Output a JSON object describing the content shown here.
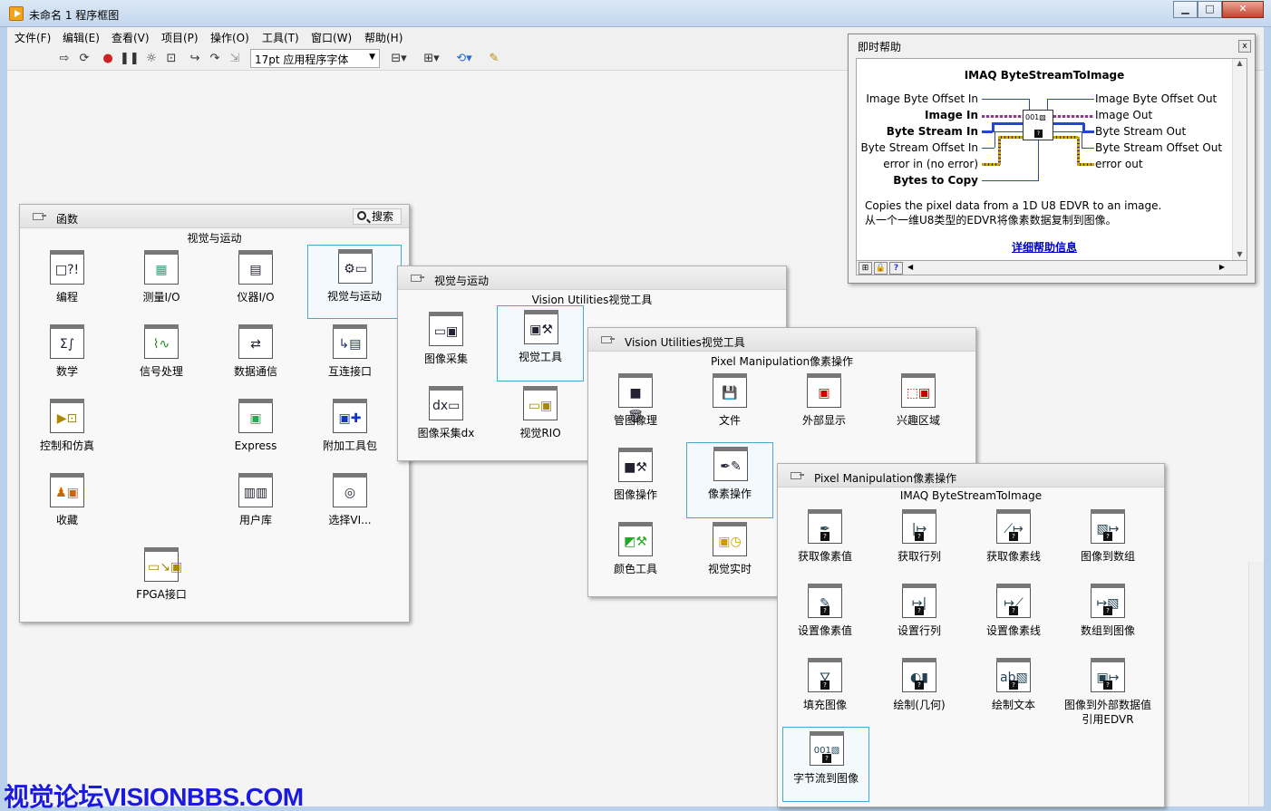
{
  "window": {
    "title": "未命名 1 程序框图",
    "btn_min": "▁",
    "btn_max": "□",
    "btn_close": "✕"
  },
  "menu": [
    "文件(F)",
    "编辑(E)",
    "查看(V)",
    "项目(P)",
    "操作(O)",
    "工具(T)",
    "窗口(W)",
    "帮助(H)"
  ],
  "toolbar": {
    "font": "17pt 应用程序字体",
    "arrow": "▼"
  },
  "functions": {
    "title": "函数",
    "search": "搜索",
    "subtitle": "视觉与运动",
    "items": [
      {
        "label": "编程",
        "icon": "programming-icon"
      },
      {
        "label": "测量I/O",
        "icon": "measurement-io-icon"
      },
      {
        "label": "仪器I/O",
        "icon": "instrument-io-icon"
      },
      {
        "label": "视觉与运动",
        "icon": "vision-motion-icon"
      },
      {
        "label": "数学",
        "icon": "math-icon"
      },
      {
        "label": "信号处理",
        "icon": "signal-processing-icon"
      },
      {
        "label": "数据通信",
        "icon": "data-comm-icon"
      },
      {
        "label": "互连接口",
        "icon": "connectivity-icon"
      },
      {
        "label": "控制和仿真",
        "icon": "control-sim-icon"
      },
      {
        "label": "Express",
        "icon": "express-icon"
      },
      {
        "label": "附加工具包",
        "icon": "addons-icon"
      },
      {
        "label": "收藏",
        "icon": "favorites-icon"
      },
      {
        "label": "用户库",
        "icon": "user-libraries-icon"
      },
      {
        "label": "选择VI...",
        "icon": "select-vi-icon"
      },
      {
        "label": "FPGA接口",
        "icon": "fpga-interface-icon"
      }
    ]
  },
  "vision": {
    "title": "视觉与运动",
    "subtitle": "Vision Utilities视觉工具",
    "items": [
      {
        "label": "图像采集",
        "icon": "image-acquisition-icon"
      },
      {
        "label": "视觉工具",
        "icon": "vision-utilities-icon"
      },
      {
        "label": "图像采集dx",
        "icon": "image-acquisition-dx-icon"
      },
      {
        "label": "视觉RIO",
        "icon": "vision-rio-icon"
      }
    ]
  },
  "utilities": {
    "title": "Vision Utilities视觉工具",
    "subtitle": "Pixel Manipulation像素操作",
    "items": [
      {
        "label": "管图像理",
        "icon": "image-management-icon"
      },
      {
        "label": "文件",
        "icon": "files-icon"
      },
      {
        "label": "外部显示",
        "icon": "external-display-icon"
      },
      {
        "label": "兴趣区域",
        "icon": "roi-icon"
      },
      {
        "label": "图像操作",
        "icon": "image-manipulation-icon"
      },
      {
        "label": "像素操作",
        "icon": "pixel-manipulation-icon"
      },
      {
        "label": "颜色工具",
        "icon": "color-utilities-icon"
      },
      {
        "label": "视觉实时",
        "icon": "vision-rt-icon"
      }
    ]
  },
  "pixel": {
    "title": "Pixel Manipulation像素操作",
    "subtitle": "IMAQ ByteStreamToImage",
    "items": [
      {
        "label": "获取像素值",
        "icon": "get-pixel-value-icon"
      },
      {
        "label": "获取行列",
        "icon": "get-row-col-icon"
      },
      {
        "label": "获取像素线",
        "icon": "get-pixel-line-icon"
      },
      {
        "label": "图像到数组",
        "icon": "image-to-array-icon"
      },
      {
        "label": "设置像素值",
        "icon": "set-pixel-value-icon"
      },
      {
        "label": "设置行列",
        "icon": "set-row-col-icon"
      },
      {
        "label": "设置像素线",
        "icon": "set-pixel-line-icon"
      },
      {
        "label": "数组到图像",
        "icon": "array-to-image-icon"
      },
      {
        "label": "填充图像",
        "icon": "fill-image-icon"
      },
      {
        "label": "绘制(几何)",
        "icon": "draw-shape-icon"
      },
      {
        "label": "绘制文本",
        "icon": "draw-text-icon"
      },
      {
        "label": "图像到外部数据值引用EDVR",
        "icon": "image-to-edvr-icon"
      },
      {
        "label": "字节流到图像",
        "icon": "bytestream-to-image-icon"
      }
    ]
  },
  "help": {
    "title": "即时帮助",
    "function": "IMAQ ByteStreamToImage",
    "inputs": [
      "Image Byte Offset In",
      "Image In",
      "Byte Stream In",
      "Byte Stream Offset In",
      "error in (no error)",
      "Bytes to Copy"
    ],
    "outputs": [
      "Image Byte Offset Out",
      "Image Out",
      "Byte Stream Out",
      "Byte Stream Offset Out",
      "error out"
    ],
    "desc_en": "Copies the pixel data from a 1D U8 EDVR to an image.",
    "desc_cn": "从一个一维U8类型的EDVR将像素数据复制到图像。",
    "link": "详细帮助信息",
    "close": "x"
  },
  "watermark": "视觉论坛VISIONBBS.COM"
}
